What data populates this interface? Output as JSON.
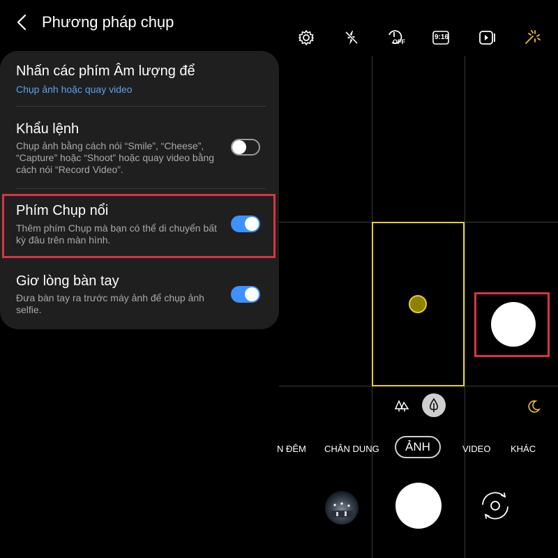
{
  "header": {
    "title": "Phương pháp chụp"
  },
  "settings": {
    "items": [
      {
        "title": "Nhấn các phím Âm lượng để",
        "subtitle": "Chụp ảnh hoặc quay video"
      },
      {
        "title": "Khẩu lệnh",
        "subtitle": "Chụp ảnh bằng cách nói “Smile”, “Cheese”, “Capture” hoặc “Shoot” hoặc quay video bằng cách nói “Record Video”.",
        "toggle_on": false
      },
      {
        "title": "Phím Chụp nổi",
        "subtitle": "Thêm phím Chụp mà bạn có thể di chuyển bất kỳ đâu trên màn hình.",
        "toggle_on": true
      },
      {
        "title": "Giơ lòng bàn tay",
        "subtitle": "Đưa bàn tay ra trước máy ảnh để chụp ảnh selfie.",
        "toggle_on": true
      }
    ]
  },
  "camera": {
    "toolbar_icons": [
      "gear-icon",
      "flash-off-icon",
      "timer-off-icon",
      "aspect-ratio-icon",
      "motion-photo-icon",
      "filter-sparkle-icon"
    ],
    "timer_label": "OFF",
    "ratio_label": "9:16",
    "modes": {
      "night": "N ĐÊM",
      "portrait": "CHÂN DUNG",
      "photo": "ẢNH",
      "video": "VIDEO",
      "more": "KHÁC"
    },
    "selected_mode": "ẢNH"
  },
  "colors": {
    "accent_blue": "#3e91ff",
    "link_blue": "#5aa2f0",
    "highlight_red": "#d93443",
    "focus_yellow": "#e6d21e",
    "icon_yellow": "#f2c230"
  }
}
